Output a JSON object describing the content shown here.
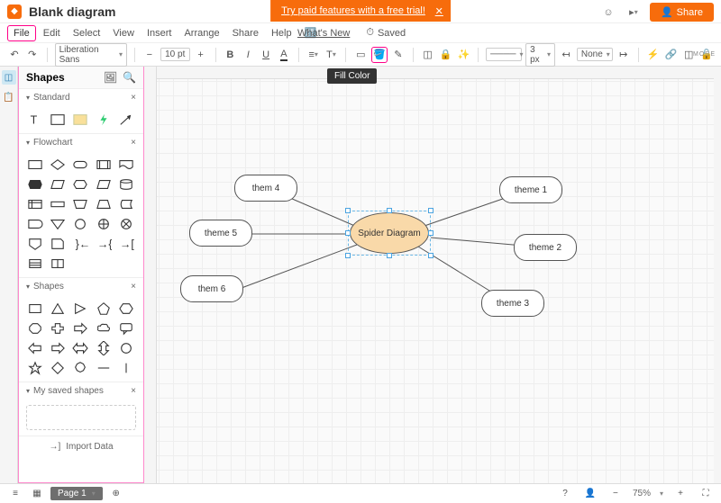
{
  "doc": {
    "title": "Blank diagram"
  },
  "banner": {
    "text": "Try paid features with a free trial!"
  },
  "header_buttons": {
    "share": "Share"
  },
  "menu": {
    "file": "File",
    "edit": "Edit",
    "select": "Select",
    "view": "View",
    "insert": "Insert",
    "arrange": "Arrange",
    "share": "Share",
    "help": "Help",
    "whats_new": "What's New",
    "saved": "Saved"
  },
  "toolbar": {
    "font": "Liberation Sans",
    "font_size": "10 pt",
    "line_style": "────",
    "line_width": "3 px",
    "none_label": "None",
    "more": "MORE"
  },
  "tooltip": {
    "fill_color": "Fill Color"
  },
  "panel": {
    "title": "Shapes",
    "sections": {
      "standard": "Standard",
      "flowchart": "Flowchart",
      "shapes": "Shapes",
      "saved": "My saved shapes"
    },
    "import": "Import Data"
  },
  "diagram": {
    "center": "Spider Diagram",
    "nodes": {
      "them4": "them 4",
      "theme5": "theme 5",
      "them6": "them 6",
      "theme1": "theme 1",
      "theme2": "theme 2",
      "theme3": "theme 3"
    }
  },
  "footer": {
    "page_label": "Page 1",
    "zoom": "75%"
  }
}
